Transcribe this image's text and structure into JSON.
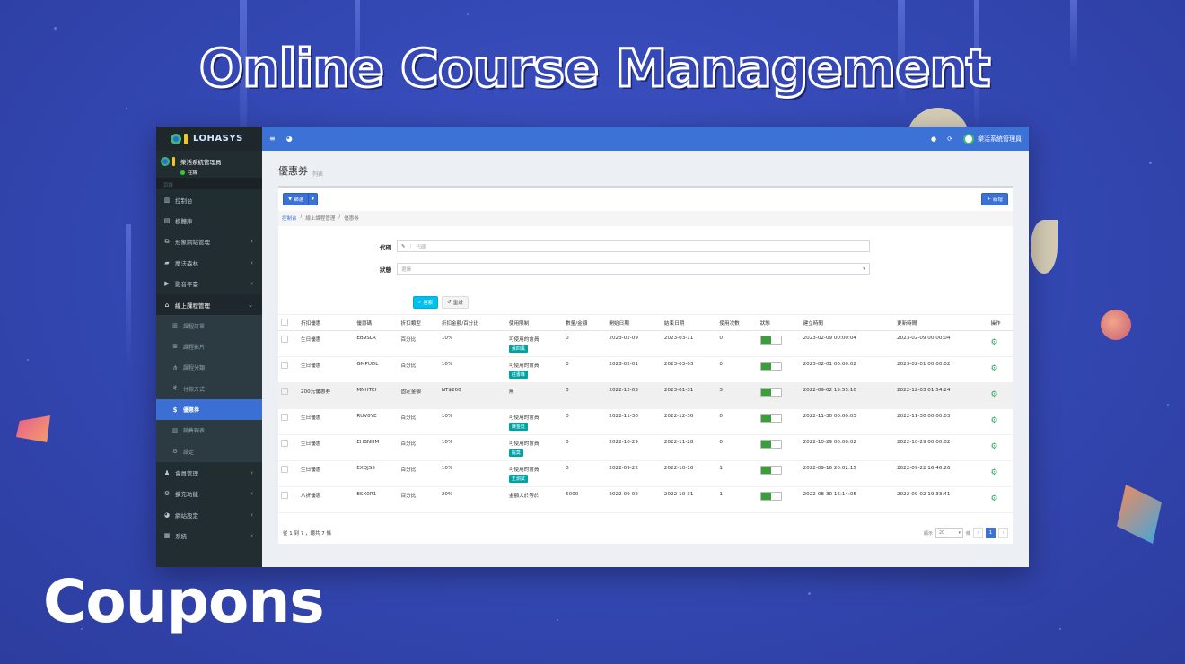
{
  "hero": {
    "title": "Online Course Management",
    "subtitle": "Coupons"
  },
  "brand": {
    "name": "LOHASYS"
  },
  "user": {
    "name": "樂活系統管理員",
    "status": "在線"
  },
  "sidebar": {
    "header": "目錄",
    "items": [
      {
        "icon": "chart-icon",
        "label": "控制台"
      },
      {
        "icon": "file-icon",
        "label": "模體庫"
      },
      {
        "icon": "copy-icon",
        "label": "形象網站管理",
        "arrow": "‹"
      },
      {
        "icon": "book-icon",
        "label": "魔法森林",
        "arrow": "‹"
      },
      {
        "icon": "video-icon",
        "label": "影音平臺",
        "arrow": "‹"
      },
      {
        "icon": "bank-icon",
        "label": "線上課程管理",
        "arrow": "⌄"
      }
    ],
    "subitems": [
      {
        "icon": "cart-icon",
        "label": "課程訂單"
      },
      {
        "icon": "list-icon",
        "label": "課程影片"
      },
      {
        "icon": "sitemap-icon",
        "label": "課程分類"
      },
      {
        "icon": "rupee-icon",
        "label": "付款方式"
      },
      {
        "icon": "dollar-icon",
        "label": "優惠券"
      },
      {
        "icon": "chart-icon",
        "label": "銷售報表"
      },
      {
        "icon": "cogs-icon",
        "label": "設定"
      }
    ],
    "bottom_items": [
      {
        "icon": "user-icon",
        "label": "會員管理",
        "arrow": "‹"
      },
      {
        "icon": "cogs-icon",
        "label": "擴充功能",
        "arrow": "‹"
      },
      {
        "icon": "globe-icon",
        "label": "網站設定",
        "arrow": "‹"
      },
      {
        "icon": "grid-icon",
        "label": "系統",
        "arrow": "‹"
      }
    ]
  },
  "topbar": {
    "user_label": "樂活系統管理員"
  },
  "page": {
    "title": "優惠券",
    "subtitle": "列表"
  },
  "toolbar": {
    "filter_label": "篩選",
    "add_label": "新增"
  },
  "breadcrumb": {
    "home": "控制台",
    "parent": "線上課程管理",
    "current": "優惠券"
  },
  "filter": {
    "code_label": "代碼",
    "code_placeholder": "代碼",
    "status_label": "狀態",
    "status_value": "選擇",
    "search_label": "搜索",
    "reset_label": "重設"
  },
  "table": {
    "headers": [
      "折扣優惠",
      "優惠碼",
      "折扣類型",
      "折扣金額/百分比",
      "使用限制",
      "數量/金額",
      "開始日期",
      "結束日期",
      "使用次數",
      "狀態",
      "建立時間",
      "更新時間",
      "操作"
    ],
    "rows": [
      {
        "name": "生日優惠",
        "code": "EB9SLR",
        "type": "百分比",
        "amount": "10%",
        "limit": "可使用的會員",
        "tag": "黃四風",
        "qty": "0",
        "start": "2023-02-09",
        "end": "2023-03-11",
        "used": "0",
        "created": "2023-02-09 00:00:04",
        "updated": "2023-02-09 00:00:04"
      },
      {
        "name": "生日優惠",
        "code": "GMPUDL",
        "type": "百分比",
        "amount": "10%",
        "limit": "可使用的會員",
        "tag": "莊書峰",
        "qty": "0",
        "start": "2023-02-01",
        "end": "2023-03-03",
        "used": "0",
        "created": "2023-02-01 00:00:02",
        "updated": "2023-02-01 00:00:02"
      },
      {
        "name": "200元優惠券",
        "code": "MNHTEI",
        "type": "固定金額",
        "amount": "NT$200",
        "limit": "無",
        "tag": "",
        "qty": "0",
        "start": "2022-12-03",
        "end": "2023-01-31",
        "used": "3",
        "created": "2022-09-02 15:55:10",
        "updated": "2022-12-03 01:54:24"
      },
      {
        "name": "生日優惠",
        "code": "RUV8YE",
        "type": "百分比",
        "amount": "10%",
        "limit": "可使用的會員",
        "tag": "陳金廷",
        "qty": "0",
        "start": "2022-11-30",
        "end": "2022-12-30",
        "used": "0",
        "created": "2022-11-30 00:00:03",
        "updated": "2022-11-30 00:00:03"
      },
      {
        "name": "生日優惠",
        "code": "EHBNHM",
        "type": "百分比",
        "amount": "10%",
        "limit": "可使用的會員",
        "tag": "提莫",
        "qty": "0",
        "start": "2022-10-29",
        "end": "2022-11-28",
        "used": "0",
        "created": "2022-10-29 00:00:02",
        "updated": "2022-10-29 00:00:02"
      },
      {
        "name": "生日優惠",
        "code": "EXQJS5",
        "type": "百分比",
        "amount": "10%",
        "limit": "可使用的會員",
        "tag": "王測試",
        "qty": "0",
        "start": "2022-09-22",
        "end": "2022-10-16",
        "used": "1",
        "created": "2022-09-16 20:02:15",
        "updated": "2022-09-22 16:46:26"
      },
      {
        "name": "八折優惠",
        "code": "ESX0R1",
        "type": "百分比",
        "amount": "20%",
        "limit": "金額大於等於",
        "tag": "",
        "qty": "5000",
        "start": "2022-09-02",
        "end": "2022-10-31",
        "used": "1",
        "created": "2022-08-30 16:14:05",
        "updated": "2022-09-02 19:33:41"
      }
    ]
  },
  "footer": {
    "summary": "從 1 到 7 ，總共 7 條",
    "show_label": "顯示",
    "page_size": "20",
    "unit_label": "條",
    "prev": "‹",
    "current_page": "1",
    "next": "›"
  },
  "colors": {
    "primary": "#3c71d6",
    "sidebar": "#222d32",
    "toggle_on": "#3c9d3c",
    "tag": "#00a3a3"
  }
}
